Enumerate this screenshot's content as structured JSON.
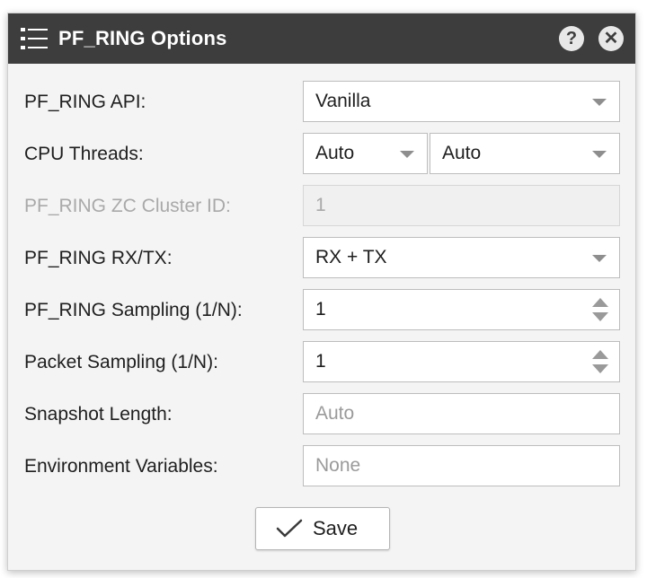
{
  "dialog": {
    "title": "PF_RING Options",
    "help_label": "?",
    "close_label": "✕"
  },
  "fields": {
    "api": {
      "label": "PF_RING API:",
      "value": "Vanilla"
    },
    "cpu_threads": {
      "label": "CPU Threads:",
      "value_a": "Auto",
      "value_b": "Auto"
    },
    "zc_cluster": {
      "label": "PF_RING ZC Cluster ID:",
      "value": "1",
      "disabled": true
    },
    "rxtx": {
      "label": "PF_RING RX/TX:",
      "value": "RX + TX"
    },
    "pf_sampling": {
      "label": "PF_RING Sampling (1/N):",
      "value": "1"
    },
    "packet_sampling": {
      "label": "Packet Sampling (1/N):",
      "value": "1"
    },
    "snapshot": {
      "label": "Snapshot Length:",
      "placeholder": "Auto"
    },
    "env_vars": {
      "label": "Environment Variables:",
      "placeholder": "None"
    }
  },
  "actions": {
    "save_label": "Save"
  },
  "icons": {
    "title": "list-icon",
    "help": "help-icon",
    "close": "close-icon",
    "save": "checkmark-icon",
    "select": "caret-down-icon",
    "spinner": "spinner-arrows-icon"
  },
  "colors": {
    "titlebar": "#3d3d3d",
    "panel": "#f4f4f4",
    "disabled_text": "#a9a9a9"
  }
}
